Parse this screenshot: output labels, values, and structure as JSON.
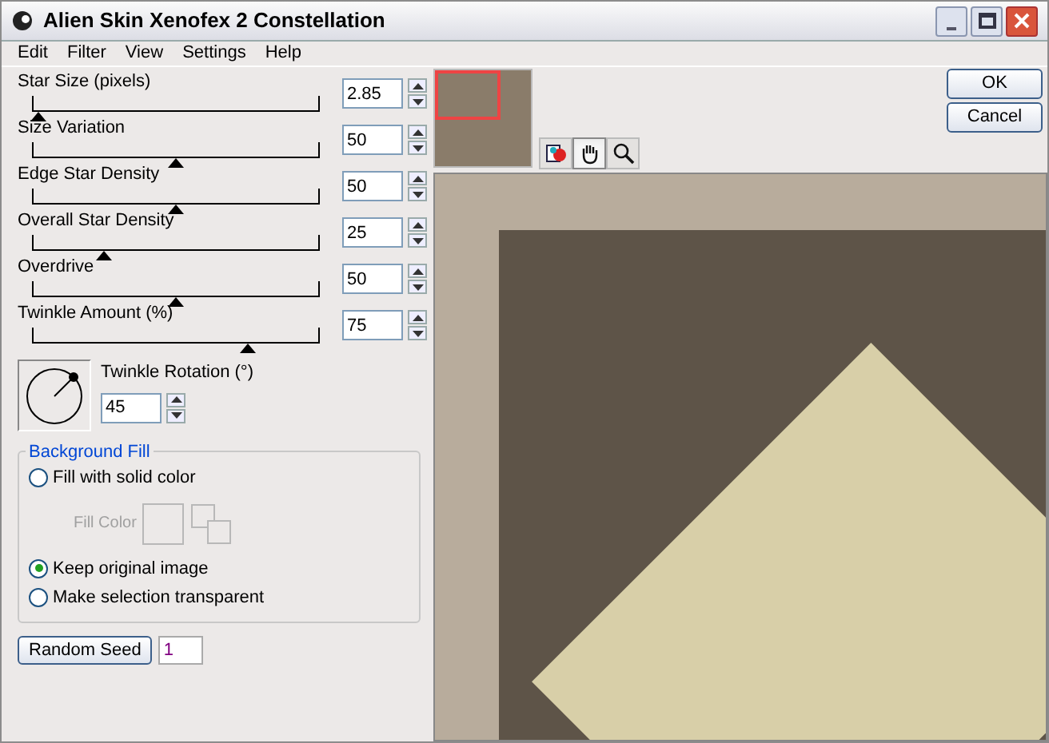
{
  "window": {
    "title": "Alien Skin Xenofex 2 Constellation"
  },
  "menu": [
    "Edit",
    "Filter",
    "View",
    "Settings",
    "Help"
  ],
  "sliders": [
    {
      "label": "Star Size (pixels)",
      "value": "2.85",
      "level": 0.02
    },
    {
      "label": "Size Variation",
      "value": "50",
      "level": 0.5
    },
    {
      "label": "Edge Star Density",
      "value": "50",
      "level": 0.5
    },
    {
      "label": "Overall Star Density",
      "value": "25",
      "level": 0.25
    },
    {
      "label": "Overdrive",
      "value": "50",
      "level": 0.5
    },
    {
      "label": "Twinkle Amount (%)",
      "value": "75",
      "level": 0.75
    }
  ],
  "rotation": {
    "label": "Twinkle Rotation (°)",
    "value": "45"
  },
  "background_fill": {
    "title": "Background Fill",
    "fill_color_label": "Fill Color",
    "options": [
      {
        "label": "Fill with solid color",
        "selected": false
      },
      {
        "label": "Keep original image",
        "selected": true
      },
      {
        "label": "Make selection transparent",
        "selected": false
      }
    ]
  },
  "random_seed": {
    "button": "Random Seed",
    "value": "1"
  },
  "tools": [
    {
      "kind": "preview",
      "selected": false
    },
    {
      "kind": "hand",
      "selected": true
    },
    {
      "kind": "zoom",
      "selected": false
    }
  ],
  "buttons": [
    "OK",
    "Cancel"
  ]
}
